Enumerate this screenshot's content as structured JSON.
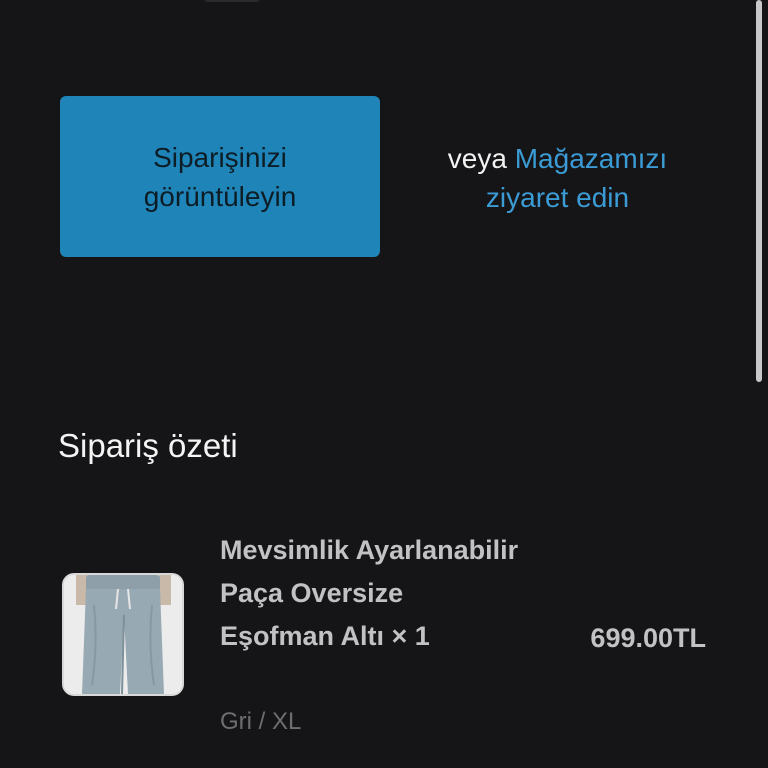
{
  "actions": {
    "view_order_label": "Siparişinizi görüntüleyin",
    "or_text": "veya",
    "store_link_label": "Mağazamızı ziyaret edin"
  },
  "order_summary": {
    "title": "Sipariş özeti",
    "items": [
      {
        "name": "Mevsimlik Ayarlanabilir Paça Oversize Eşofman Altı × 1",
        "variant": "Gri / XL",
        "price": "699.00TL",
        "thumbnail_icon": "grey-sweatpants-image"
      }
    ]
  },
  "colors": {
    "background": "#151517",
    "button": "#1f85b9",
    "link": "#3b9bd4"
  }
}
